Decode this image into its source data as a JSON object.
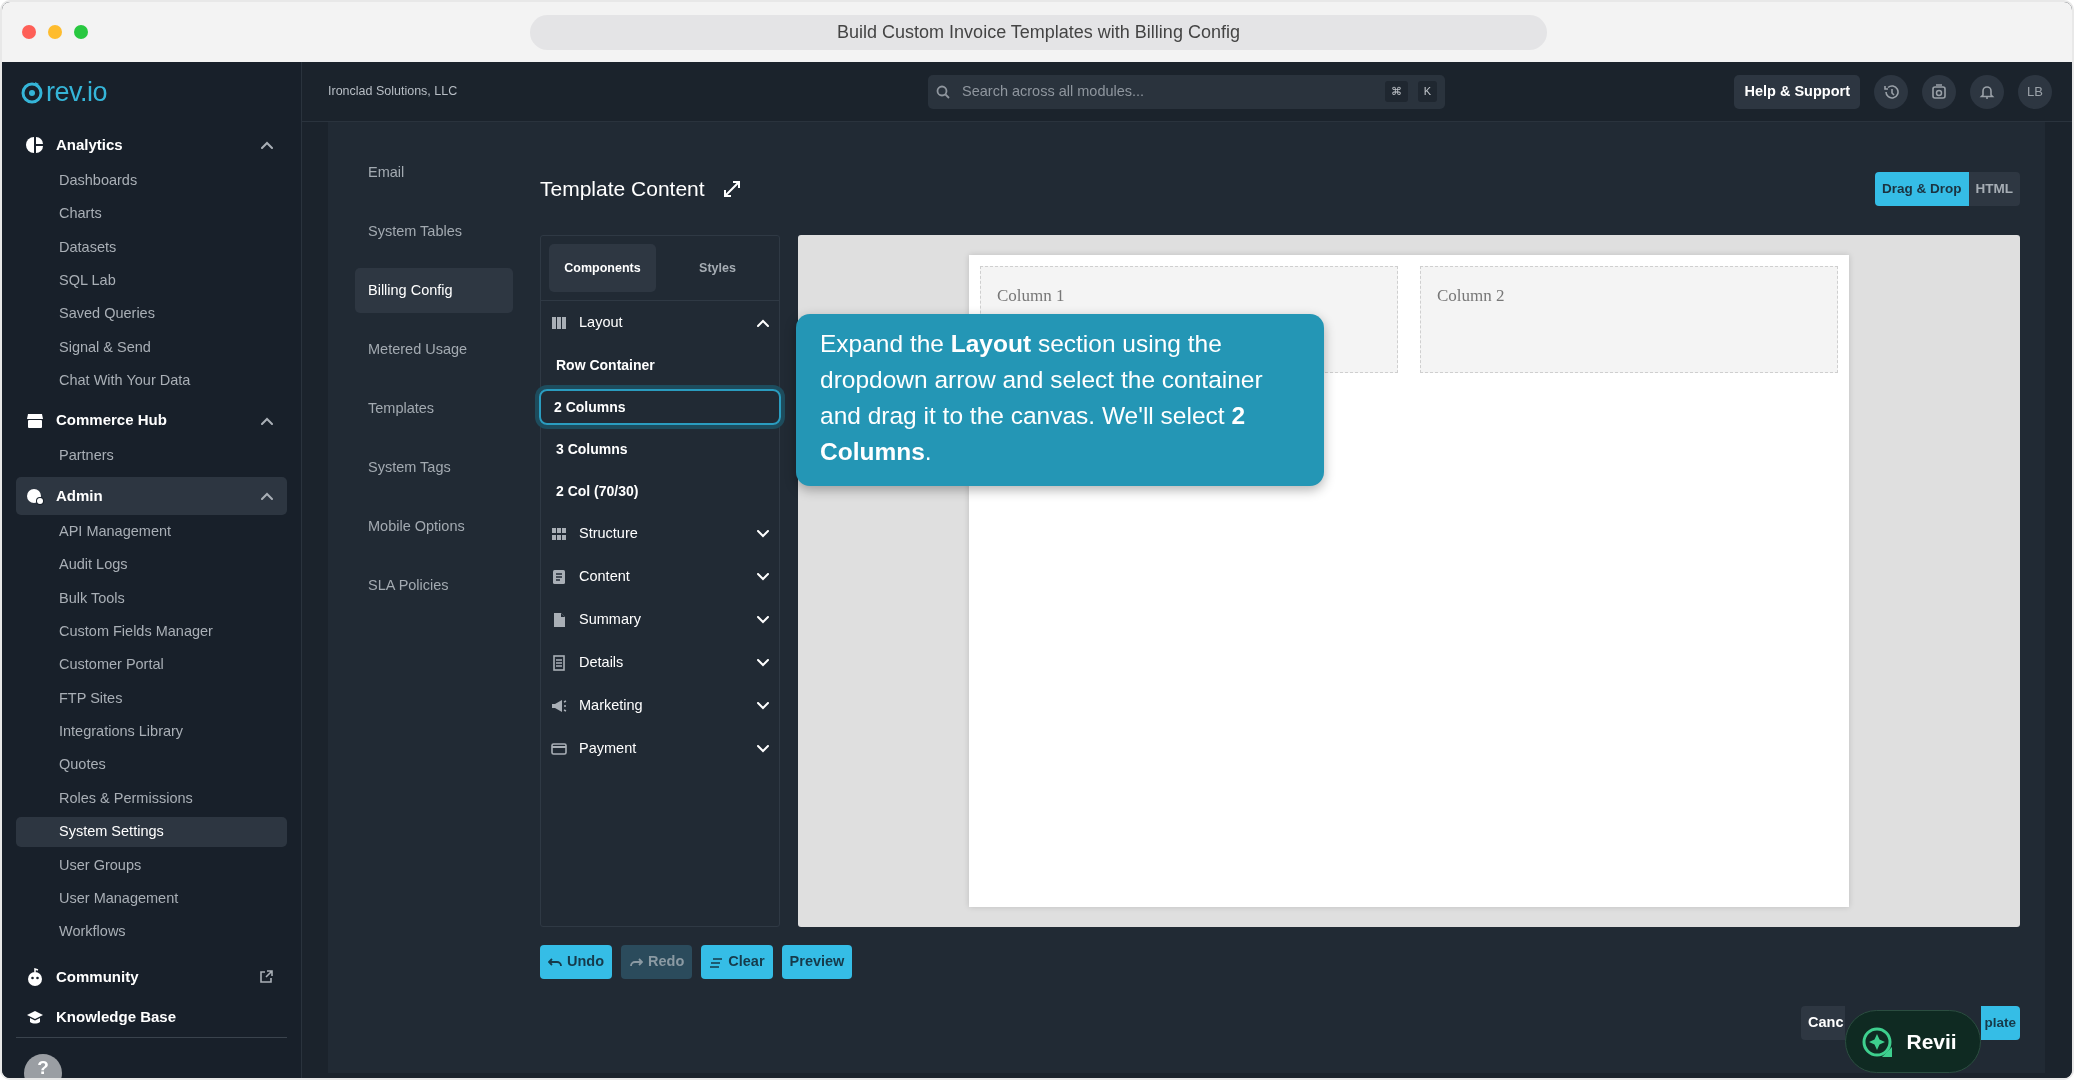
{
  "window": {
    "title": "Build Custom Invoice Templates with Billing Config"
  },
  "sidebar": {
    "logo": "rev.io",
    "groups": [
      {
        "label": "Analytics",
        "expanded": true,
        "selected": false,
        "items": [
          {
            "label": "Dashboards",
            "selected": false
          },
          {
            "label": "Charts",
            "selected": false
          },
          {
            "label": "Datasets",
            "selected": false
          },
          {
            "label": "SQL Lab",
            "selected": false
          },
          {
            "label": "Saved Queries",
            "selected": false
          },
          {
            "label": "Signal & Send",
            "selected": false
          },
          {
            "label": "Chat With Your Data",
            "selected": false
          }
        ]
      },
      {
        "label": "Commerce Hub",
        "expanded": true,
        "selected": false,
        "items": [
          {
            "label": "Partners",
            "selected": false
          }
        ]
      },
      {
        "label": "Admin",
        "expanded": true,
        "selected": true,
        "items": [
          {
            "label": "API Management",
            "selected": false
          },
          {
            "label": "Audit Logs",
            "selected": false
          },
          {
            "label": "Bulk Tools",
            "selected": false
          },
          {
            "label": "Custom Fields Manager",
            "selected": false
          },
          {
            "label": "Customer Portal",
            "selected": false
          },
          {
            "label": "FTP Sites",
            "selected": false
          },
          {
            "label": "Integrations Library",
            "selected": false
          },
          {
            "label": "Quotes",
            "selected": false
          },
          {
            "label": "Roles & Permissions",
            "selected": false
          },
          {
            "label": "System Settings",
            "selected": true
          },
          {
            "label": "User Groups",
            "selected": false
          },
          {
            "label": "User Management",
            "selected": false
          },
          {
            "label": "Workflows",
            "selected": false
          }
        ]
      }
    ],
    "links": [
      {
        "label": "Community",
        "external": true
      },
      {
        "label": "Knowledge Base",
        "external": false
      }
    ],
    "help": "?"
  },
  "topbar": {
    "company": "Ironclad Solutions, LLC",
    "search": {
      "placeholder": "Search across all modules...",
      "keys": [
        "⌘",
        "K"
      ]
    },
    "help_button": "Help & Support",
    "avatar": "LB"
  },
  "subnav": [
    {
      "label": "Email",
      "selected": false
    },
    {
      "label": "System Tables",
      "selected": false
    },
    {
      "label": "Billing Config",
      "selected": true
    },
    {
      "label": "Metered Usage",
      "selected": false
    },
    {
      "label": "Templates",
      "selected": false
    },
    {
      "label": "System Tags",
      "selected": false
    },
    {
      "label": "Mobile Options",
      "selected": false
    },
    {
      "label": "SLA Policies",
      "selected": false
    }
  ],
  "editor": {
    "title": "Template Content",
    "modes": [
      {
        "label": "Drag & Drop",
        "selected": true
      },
      {
        "label": "HTML",
        "selected": false
      }
    ],
    "panel_tabs": [
      {
        "label": "Components",
        "selected": true
      },
      {
        "label": "Styles",
        "selected": false
      }
    ],
    "sections": [
      {
        "label": "Layout",
        "expanded": true,
        "items": [
          {
            "label": "Row Container",
            "selected": false
          },
          {
            "label": "2 Columns",
            "selected": true
          },
          {
            "label": "3 Columns",
            "selected": false
          },
          {
            "label": "2 Col (70/30)",
            "selected": false
          }
        ]
      },
      {
        "label": "Structure",
        "expanded": false
      },
      {
        "label": "Content",
        "expanded": false
      },
      {
        "label": "Summary",
        "expanded": false
      },
      {
        "label": "Details",
        "expanded": false
      },
      {
        "label": "Marketing",
        "expanded": false
      },
      {
        "label": "Payment",
        "expanded": false
      }
    ],
    "canvas": {
      "columns": [
        "Column 1",
        "Column 2"
      ]
    },
    "tooltip": "Expand the **Layout** section using the dropdown arrow and select the container and drag it to the canvas. We'll select **2 Columns**.",
    "actions": [
      {
        "label": "Undo",
        "disabled": false
      },
      {
        "label": "Redo",
        "disabled": true
      },
      {
        "label": "Clear",
        "disabled": false
      },
      {
        "label": "Preview",
        "disabled": false
      }
    ],
    "footer": [
      "Canc",
      "plate"
    ]
  },
  "assistant": {
    "label": "Revii"
  }
}
